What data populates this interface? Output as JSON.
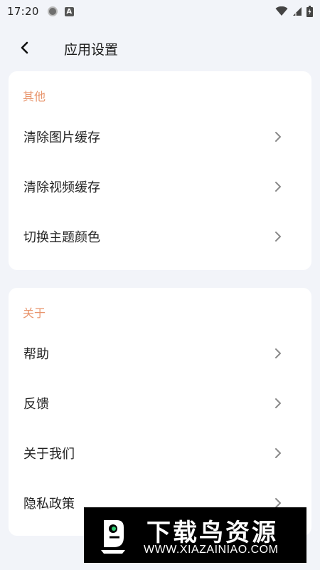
{
  "status_bar": {
    "time": "17:20",
    "app_icon": "circle-notification-icon",
    "a_badge": "A",
    "right_icons": [
      "wifi-icon",
      "signal-icon",
      "battery-icon"
    ]
  },
  "header": {
    "back_icon": "chevron-left-icon",
    "title": "应用设置"
  },
  "sections": [
    {
      "title": "其他",
      "items": [
        {
          "label": "清除图片缓存"
        },
        {
          "label": "清除视频缓存"
        },
        {
          "label": "切换主题颜色"
        }
      ]
    },
    {
      "title": "关于",
      "items": [
        {
          "label": "帮助"
        },
        {
          "label": "反馈"
        },
        {
          "label": "关于我们"
        },
        {
          "label": "隐私政策"
        }
      ]
    }
  ],
  "watermark": {
    "title": "下载鸟资源",
    "url": "WWW.XIAZAINIAO.COM"
  },
  "colors": {
    "background": "#f2f4f9",
    "card": "#ffffff",
    "section_title": "#e8956d",
    "chevron": "#8a8a8a"
  }
}
